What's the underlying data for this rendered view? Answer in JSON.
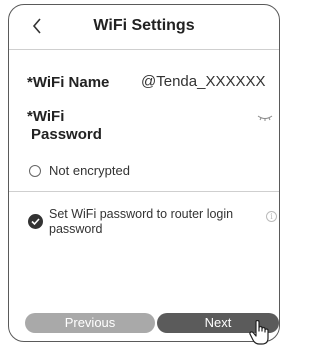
{
  "header": {
    "title": "WiFi Settings",
    "back_icon": "chevron-left-icon"
  },
  "form": {
    "wifi_name_label": "*WiFi Name",
    "wifi_name_value": "@Tenda_XXXXXX",
    "wifi_password_label_line1": "*WiFi",
    "wifi_password_label_line2": "Password",
    "eye_icon": "eye-closed-icon",
    "not_encrypted_label": "Not encrypted",
    "sync_password_label": "Set WiFi password to router login password",
    "info_icon": "info-icon"
  },
  "footer": {
    "previous_label": "Previous",
    "next_label": "Next"
  },
  "colors": {
    "accent": "#5b5b5b",
    "secondary_button": "#a9a9a9",
    "border": "#5a5a5a"
  }
}
